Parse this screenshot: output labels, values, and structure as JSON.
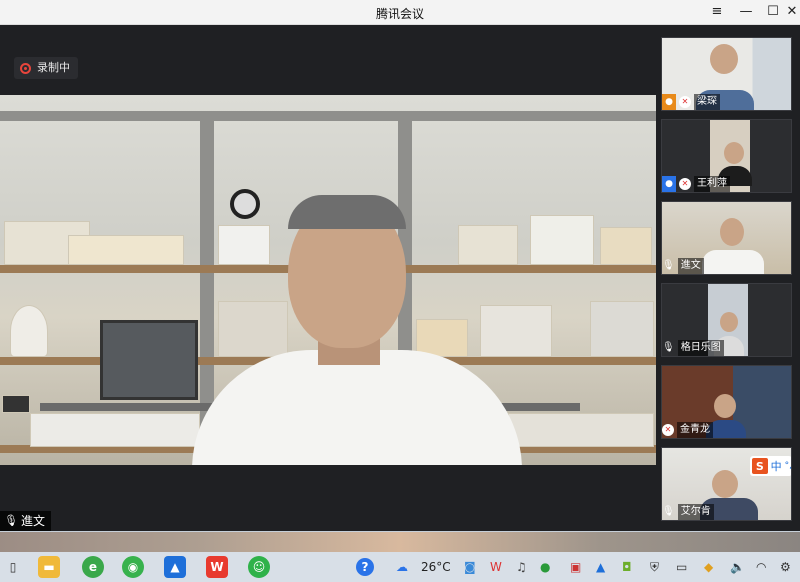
{
  "window": {
    "title": "腾讯会议",
    "menu_icon": "hamburger-icon",
    "min_icon": "minimize-icon",
    "max_icon": "maximize-icon",
    "close_icon": "close-icon"
  },
  "recording": {
    "label": "录制中",
    "color": "#e8453c"
  },
  "main_video": {
    "speaker_name": "進文",
    "mic_icon": "microphone-icon"
  },
  "participants": [
    {
      "name": "梁琛",
      "badge": "user-icon",
      "badge_color": "#e88a1a",
      "mic": "mic-muted-icon"
    },
    {
      "name": "王利萍",
      "badge": "user-icon",
      "badge_color": "#2a73e8",
      "mic": "mic-muted-icon"
    },
    {
      "name": "進文",
      "mic": "microphone-icon"
    },
    {
      "name": "格日乐图",
      "mic": "microphone-icon"
    },
    {
      "name": "金青龙",
      "mic": "mic-muted-icon"
    },
    {
      "name": "艾尔肯",
      "mic": "microphone-icon"
    }
  ],
  "ime": {
    "logo": "S",
    "mode": "中",
    "extra": "°,"
  },
  "taskbar": {
    "temperature": "26°C",
    "apps": [
      "task-view-icon",
      "file-explorer-icon",
      "browser-icon",
      "wechat-icon",
      "tencent-meeting-icon",
      "wps-icon",
      "chat-app-icon"
    ],
    "tray": [
      "help-icon",
      "weather-icon",
      "camera-icon",
      "wps-tray-icon",
      "sound-icon",
      "chat-tray-icon",
      "nvidia-icon",
      "security-icon",
      "storage-icon",
      "volume-icon",
      "wifi-icon",
      "settings-icon"
    ]
  }
}
